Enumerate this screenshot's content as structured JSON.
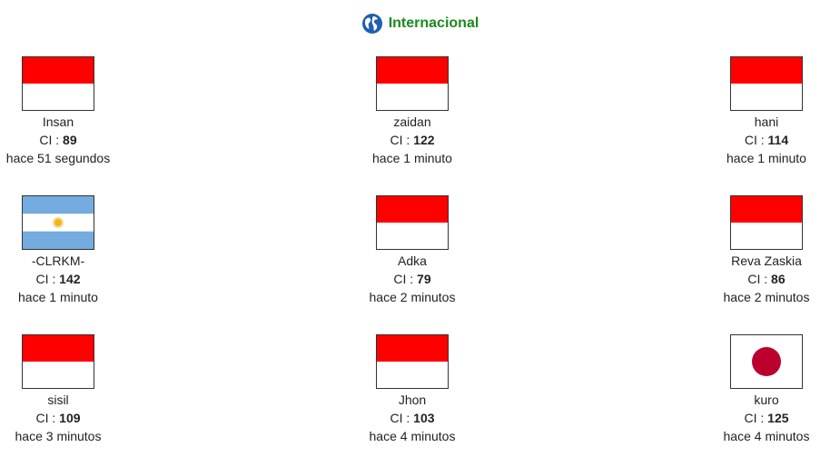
{
  "header": {
    "title": "Internacional",
    "icon": "globe-icon"
  },
  "ci_label": "CI : ",
  "colors": {
    "title_green": "#1a8a1a",
    "indonesia_red": "#ff0000",
    "argentina_blue": "#74acdf",
    "argentina_sun": "#f6b40e",
    "japan_red": "#bc002d"
  },
  "players": [
    {
      "name": "Insan",
      "ci": "89",
      "time": "hace 51 segundos",
      "flag": "indonesia"
    },
    {
      "name": "zaidan",
      "ci": "122",
      "time": "hace 1 minuto",
      "flag": "indonesia"
    },
    {
      "name": "hani",
      "ci": "114",
      "time": "hace 1 minuto",
      "flag": "indonesia"
    },
    {
      "name": "-CLRKM-",
      "ci": "142",
      "time": "hace 1 minuto",
      "flag": "argentina"
    },
    {
      "name": "Adka",
      "ci": "79",
      "time": "hace 2 minutos",
      "flag": "indonesia"
    },
    {
      "name": "Reva Zaskia",
      "ci": "86",
      "time": "hace 2 minutos",
      "flag": "indonesia"
    },
    {
      "name": "sisil",
      "ci": "109",
      "time": "hace 3 minutos",
      "flag": "indonesia"
    },
    {
      "name": "Jhon",
      "ci": "103",
      "time": "hace 4 minutos",
      "flag": "indonesia"
    },
    {
      "name": "kuro",
      "ci": "125",
      "time": "hace 4 minutos",
      "flag": "japan"
    }
  ]
}
